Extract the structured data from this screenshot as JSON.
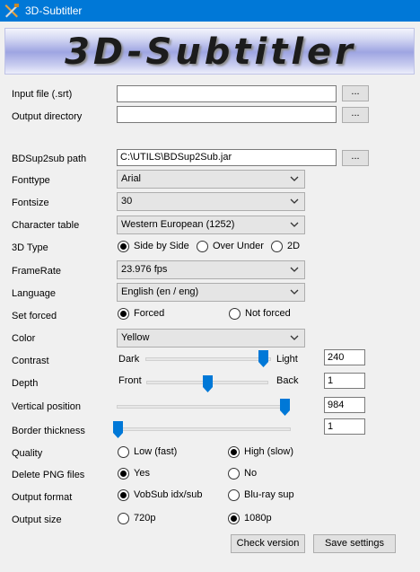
{
  "window": {
    "title": "3D-Subtitler",
    "logo_text": "3D-Subtitler"
  },
  "form": {
    "input_file": {
      "label": "Input file (.srt)",
      "value": "",
      "browse_label": "..."
    },
    "output_directory": {
      "label": "Output directory",
      "value": "",
      "browse_label": "..."
    },
    "bdsup2sub_path": {
      "label": "BDSup2sub path",
      "value": "C:\\UTILS\\BDSup2Sub.jar",
      "browse_label": "..."
    },
    "fonttype": {
      "label": "Fonttype",
      "value": "Arial"
    },
    "fontsize": {
      "label": "Fontsize",
      "value": "30"
    },
    "character_table": {
      "label": "Character table",
      "value": "Western European (1252)"
    },
    "type_3d": {
      "label": "3D Type",
      "options": [
        "Side by Side",
        "Over Under",
        "2D"
      ],
      "selected": "Side by Side"
    },
    "framerate": {
      "label": "FrameRate",
      "value": "23.976 fps"
    },
    "language": {
      "label": "Language",
      "value": "English (en / eng)"
    },
    "set_forced": {
      "label": "Set forced",
      "options": [
        "Forced",
        "Not forced"
      ],
      "selected": "Forced"
    },
    "color": {
      "label": "Color",
      "value": "Yellow"
    },
    "contrast": {
      "label": "Contrast",
      "min_label": "Dark",
      "max_label": "Light",
      "value": "240",
      "level": 0.94
    },
    "depth": {
      "label": "Depth",
      "min_label": "Front",
      "max_label": "Back",
      "value": "1",
      "level": 0.5
    },
    "vertical_position": {
      "label": "Vertical position",
      "value": "984",
      "level": 1.0
    },
    "border_thickness": {
      "label": "Border thickness",
      "value": "1",
      "level": 0.0
    },
    "quality": {
      "label": "Quality",
      "options": [
        "Low (fast)",
        "High (slow)"
      ],
      "selected": "High (slow)"
    },
    "delete_png": {
      "label": "Delete PNG files",
      "options": [
        "Yes",
        "No"
      ],
      "selected": "Yes"
    },
    "output_format": {
      "label": "Output format",
      "options": [
        "VobSub idx/sub",
        "Blu-ray sup"
      ],
      "selected": "VobSub idx/sub"
    },
    "output_size": {
      "label": "Output size",
      "options": [
        "720p",
        "1080p"
      ],
      "selected": "1080p"
    }
  },
  "buttons": {
    "check_version": "Check version",
    "save_settings": "Save settings"
  },
  "icons": {
    "app": "crossed-tools-icon",
    "dropdown": "chevron-down-icon",
    "slider": "slider-thumb-icon"
  },
  "colors": {
    "titlebar": "#0078d7",
    "slider_thumb": "#0078d7",
    "window_bg": "#f0f0f0"
  }
}
